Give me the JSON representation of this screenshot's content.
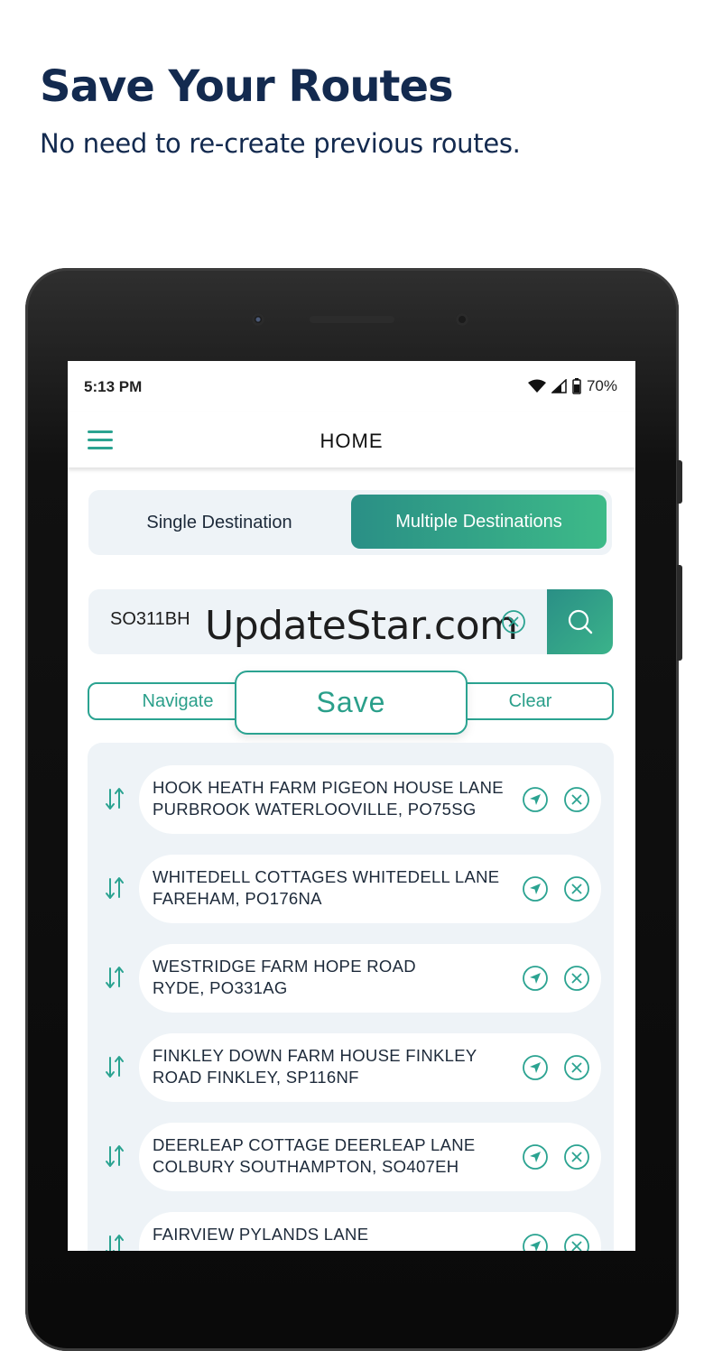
{
  "promo": {
    "title": "Save Your Routes",
    "subtitle": "No need to re-create previous routes."
  },
  "status_bar": {
    "time": "5:13 PM",
    "battery": "70%"
  },
  "app_bar": {
    "title": "HOME"
  },
  "mode_toggle": {
    "single": "Single Destination",
    "multiple": "Multiple Destinations",
    "selected": "multiple"
  },
  "search": {
    "value": "SO311BH",
    "watermark": "UpdateStar.com"
  },
  "actions": {
    "navigate": "Navigate",
    "save": "Save",
    "clear": "Clear"
  },
  "colors": {
    "accent": "#2ba391",
    "accent_gradient_end": "#3dba88",
    "headline": "#132a4f",
    "panel": "#eef3f7"
  },
  "destinations": [
    {
      "line1": "HOOK HEATH FARM PIGEON HOUSE LANE",
      "line2": "PURBROOK WATERLOOVILLE, PO75SG"
    },
    {
      "line1": "WHITEDELL COTTAGES WHITEDELL LANE",
      "line2": "FAREHAM, PO176NA"
    },
    {
      "line1": "WESTRIDGE FARM HOPE ROAD",
      "line2": "RYDE, PO331AG"
    },
    {
      "line1": "FINKLEY DOWN FARM HOUSE FINKLEY",
      "line2": "ROAD FINKLEY, SP116NF"
    },
    {
      "line1": "DEERLEAP COTTAGE DEERLEAP LANE",
      "line2": "COLBURY SOUTHAMPTON, SO407EH"
    },
    {
      "line1": "FAIRVIEW PYLANDS LANE",
      "line2": ""
    }
  ]
}
